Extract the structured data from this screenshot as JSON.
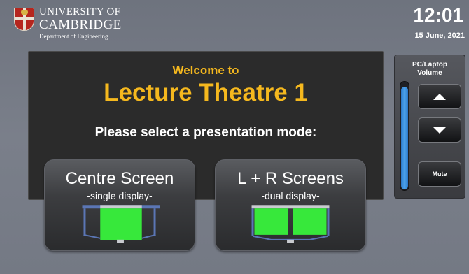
{
  "header": {
    "university_line1": "UNIVERSITY OF",
    "university_line2": "CAMBRIDGE",
    "department": "Department of Engineering",
    "time": "12:01",
    "date": "15 June, 2021"
  },
  "welcome": {
    "greeting": "Welcome to",
    "room_name": "Lecture Theatre 1",
    "prompt": "Please select a presentation mode:"
  },
  "modes": [
    {
      "title": "Centre Screen",
      "subtitle": "-single display-",
      "screens": 1
    },
    {
      "title": "L + R Screens",
      "subtitle": "-dual display-",
      "screens": 2
    }
  ],
  "volume": {
    "title_line1": "PC/Laptop",
    "title_line2": "Volume",
    "level": 0.96,
    "mute_label": "Mute",
    "up_icon": "triangle-up-icon",
    "down_icon": "triangle-down-icon"
  },
  "colors": {
    "accent": "#f5b81e",
    "screen_green": "#37e83b",
    "volume_blue": "#3a8fde",
    "brand_red": "#b5261e"
  }
}
